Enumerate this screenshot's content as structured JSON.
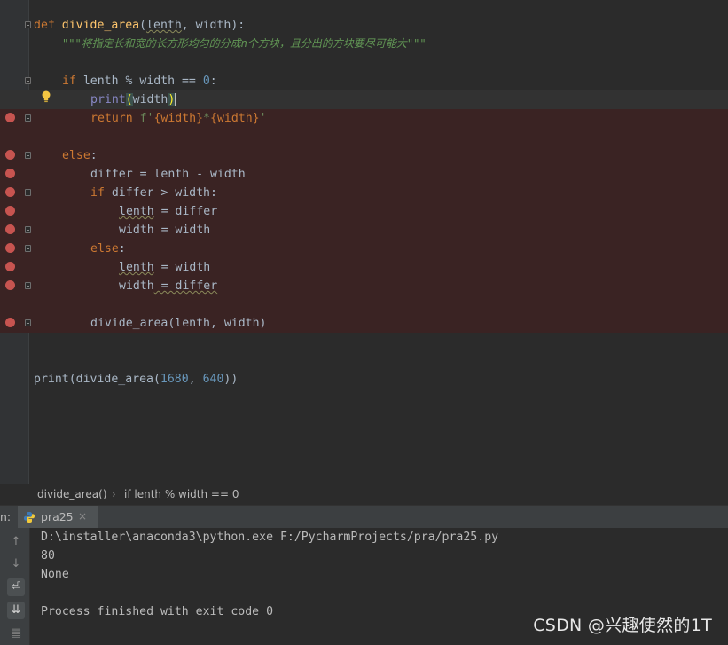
{
  "editor": {
    "lines": {
      "def_kw": "def",
      "def_fn": "divide_area",
      "def_param1": "lenth",
      "def_rest": ", width):",
      "docstring": "\"\"\"将指定长和宽的长方形均匀的分成n个方块，且分出的方块要尽可能大\"\"\"",
      "if_kw": "if",
      "if_cond": " lenth % width == ",
      "if_num": "0",
      "if_colon": ":",
      "print_bi": "print",
      "print_arg": "width",
      "return_kw": "return",
      "return_str_a": " f'",
      "return_f1": "{width}",
      "return_star": "*",
      "return_f2": "{width}",
      "return_str_b": "'",
      "else1": "else",
      "differ_assign": "differ = lenth - width",
      "if2_kw": "if",
      "if2_cond": " differ > width:",
      "l1_var": "lenth",
      "l1_rest": " = differ",
      "w1": "width = width",
      "else2": "else",
      "l2_var": "lenth",
      "l2_rest": " = width",
      "w2_a": "width",
      "w2_squig": " = differ",
      "recurse": "divide_area(lenth, width)",
      "print_call_a": "print(divide_area(",
      "print_n1": "1680",
      "print_sep": ", ",
      "print_n2": "640",
      "print_end": "))"
    }
  },
  "breadcrumb": {
    "item1": "divide_area()",
    "sep": "›",
    "item2": "if lenth % width == 0"
  },
  "run": {
    "label": "n:",
    "tab_name": "pra25",
    "close": "×"
  },
  "console": {
    "line1": "D:\\installer\\anaconda3\\python.exe F:/PycharmProjects/pra/pra25.py",
    "line2": "80",
    "line3": "None",
    "line4": "Process finished with exit code 0"
  },
  "watermark": "CSDN @兴趣使然的1T",
  "colors": {
    "background": "#2b2b2b",
    "keyword": "#cc7832",
    "function": "#ffc66d",
    "number": "#6897bb",
    "docstring": "#629755",
    "breakpoint": "#c75450"
  },
  "icons": [
    "breakpoint-icon",
    "fold-icon",
    "intention-bulb-icon",
    "python-file-icon",
    "up-arrow-icon",
    "down-arrow-icon",
    "soft-wrap-icon",
    "scroll-to-end-icon",
    "print-icon"
  ]
}
